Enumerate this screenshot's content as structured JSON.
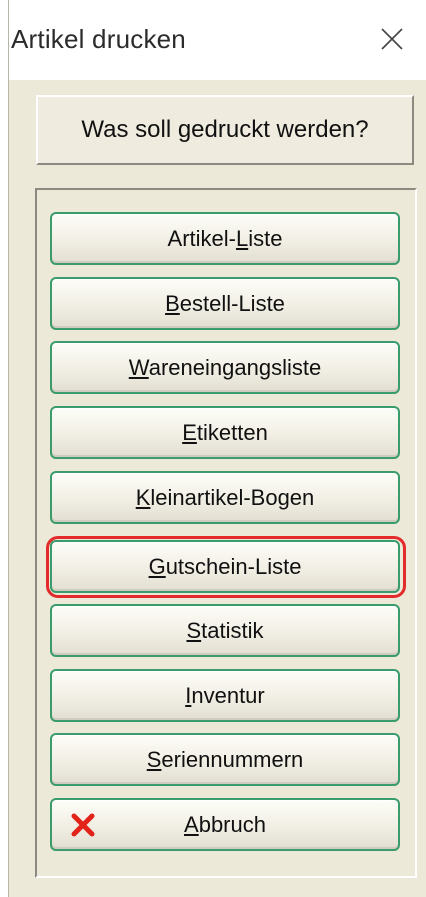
{
  "window": {
    "title": "Artikel drucken"
  },
  "header": {
    "label": "Was soll gedruckt werden?"
  },
  "buttons": [
    {
      "pre": "Artikel-",
      "key": "L",
      "post": "iste"
    },
    {
      "pre": "",
      "key": "B",
      "post": "estell-Liste"
    },
    {
      "pre": "",
      "key": "W",
      "post": "areneingangsliste"
    },
    {
      "pre": "",
      "key": "E",
      "post": "tiketten"
    },
    {
      "pre": "",
      "key": "K",
      "post": "leinartikel-Bogen"
    },
    {
      "pre": "",
      "key": "G",
      "post": "utschein-Liste"
    },
    {
      "pre": "",
      "key": "S",
      "post": "tatistik"
    },
    {
      "pre": "",
      "key": "I",
      "post": "nventur"
    },
    {
      "pre": "",
      "key": "S",
      "post": "eriennummern"
    },
    {
      "pre": "",
      "key": "A",
      "post": "bbruch"
    }
  ],
  "icons": {
    "close": "close-icon",
    "cancel": "red-x-icon"
  },
  "colors": {
    "button_border": "#3a9c6c",
    "highlight": "#e32b2b",
    "cancel_icon": "#e2231a"
  }
}
